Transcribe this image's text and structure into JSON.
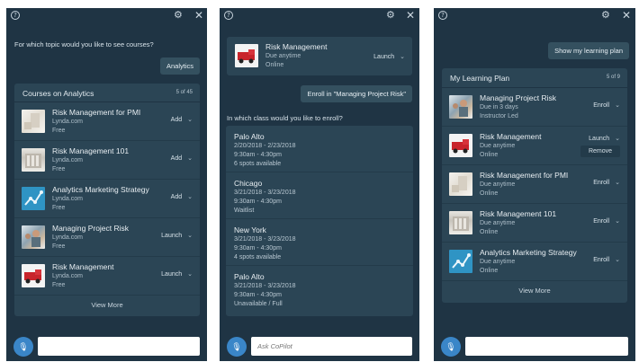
{
  "panel1": {
    "prompt": "For which topic would you like to see courses?",
    "user_msg": "Analytics",
    "card_title": "Courses on Analytics",
    "card_count": "5 of 45",
    "courses": [
      {
        "title": "Risk Management for PMI",
        "source": "Lynda.com",
        "price": "Free",
        "action": "Add",
        "thumb": "pmi-image"
      },
      {
        "title": "Risk Management 101",
        "source": "Lynda.com",
        "price": "Free",
        "action": "Add",
        "thumb": "building-image"
      },
      {
        "title": "Analytics Marketing Strategy",
        "source": "Lynda.com",
        "price": "Free",
        "action": "Add",
        "thumb": "chart-image"
      },
      {
        "title": "Managing Project Risk",
        "source": "Lynda.com",
        "price": "Free",
        "action": "Launch",
        "thumb": "people-image"
      },
      {
        "title": "Risk Management",
        "source": "Lynda.com",
        "price": "Free",
        "action": "Launch",
        "thumb": "fire-truck-image"
      }
    ],
    "view_more": "View More",
    "input_placeholder": ""
  },
  "panel2": {
    "top_course": {
      "title": "Risk Management",
      "due": "Due anytime",
      "mode": "Online",
      "action": "Launch"
    },
    "user_msg": "Enroll in \"Managing Project Risk\"",
    "prompt": "In which class would you like to enroll?",
    "classes": [
      {
        "city": "Palo Alto",
        "dates": "2/20/2018 - 2/23/2018",
        "time": "9:30am - 4:30pm",
        "status": "6 spots available"
      },
      {
        "city": "Chicago",
        "dates": "3/21/2018 - 3/23/2018",
        "time": "9:30am - 4:30pm",
        "status": "Waitlist"
      },
      {
        "city": "New York",
        "dates": "3/21/2018 - 3/23/2018",
        "time": "9:30am - 4:30pm",
        "status": "4 spots available"
      },
      {
        "city": "Palo Alto",
        "dates": "3/21/2018 - 3/23/2018",
        "time": "9:30am - 4:30pm",
        "status": "Unavailable / Full"
      }
    ],
    "input_placeholder": "Ask CoPilot"
  },
  "panel3": {
    "user_msg": "Show my learning plan",
    "card_title": "My Learning Plan",
    "card_count": "5 of 9",
    "items": [
      {
        "title": "Managing Project Risk",
        "line1": "Due in 3 days",
        "line2": "Instructor Led",
        "action": "Enroll"
      },
      {
        "title": "Risk Management",
        "line1": "Due anytime",
        "line2": "Online",
        "action": "Launch",
        "extra": "Remove"
      },
      {
        "title": "Risk Management for PMI",
        "line1": "Due anytime",
        "line2": "Online",
        "action": "Enroll"
      },
      {
        "title": "Risk Management 101",
        "line1": "Due anytime",
        "line2": "Online",
        "action": "Enroll"
      },
      {
        "title": "Analytics Marketing Strategy",
        "line1": "Due anytime",
        "line2": "Online",
        "action": "Enroll"
      }
    ],
    "view_more": "View More",
    "input_placeholder": ""
  },
  "icons": {
    "help": "?",
    "gear": "⚙",
    "close": "✕",
    "chevron": "⌄",
    "mic": "🎙"
  },
  "colors": {
    "panel_bg": "#1f3444",
    "card_bg": "#2b4555",
    "mic_blue": "#3a86c8"
  }
}
